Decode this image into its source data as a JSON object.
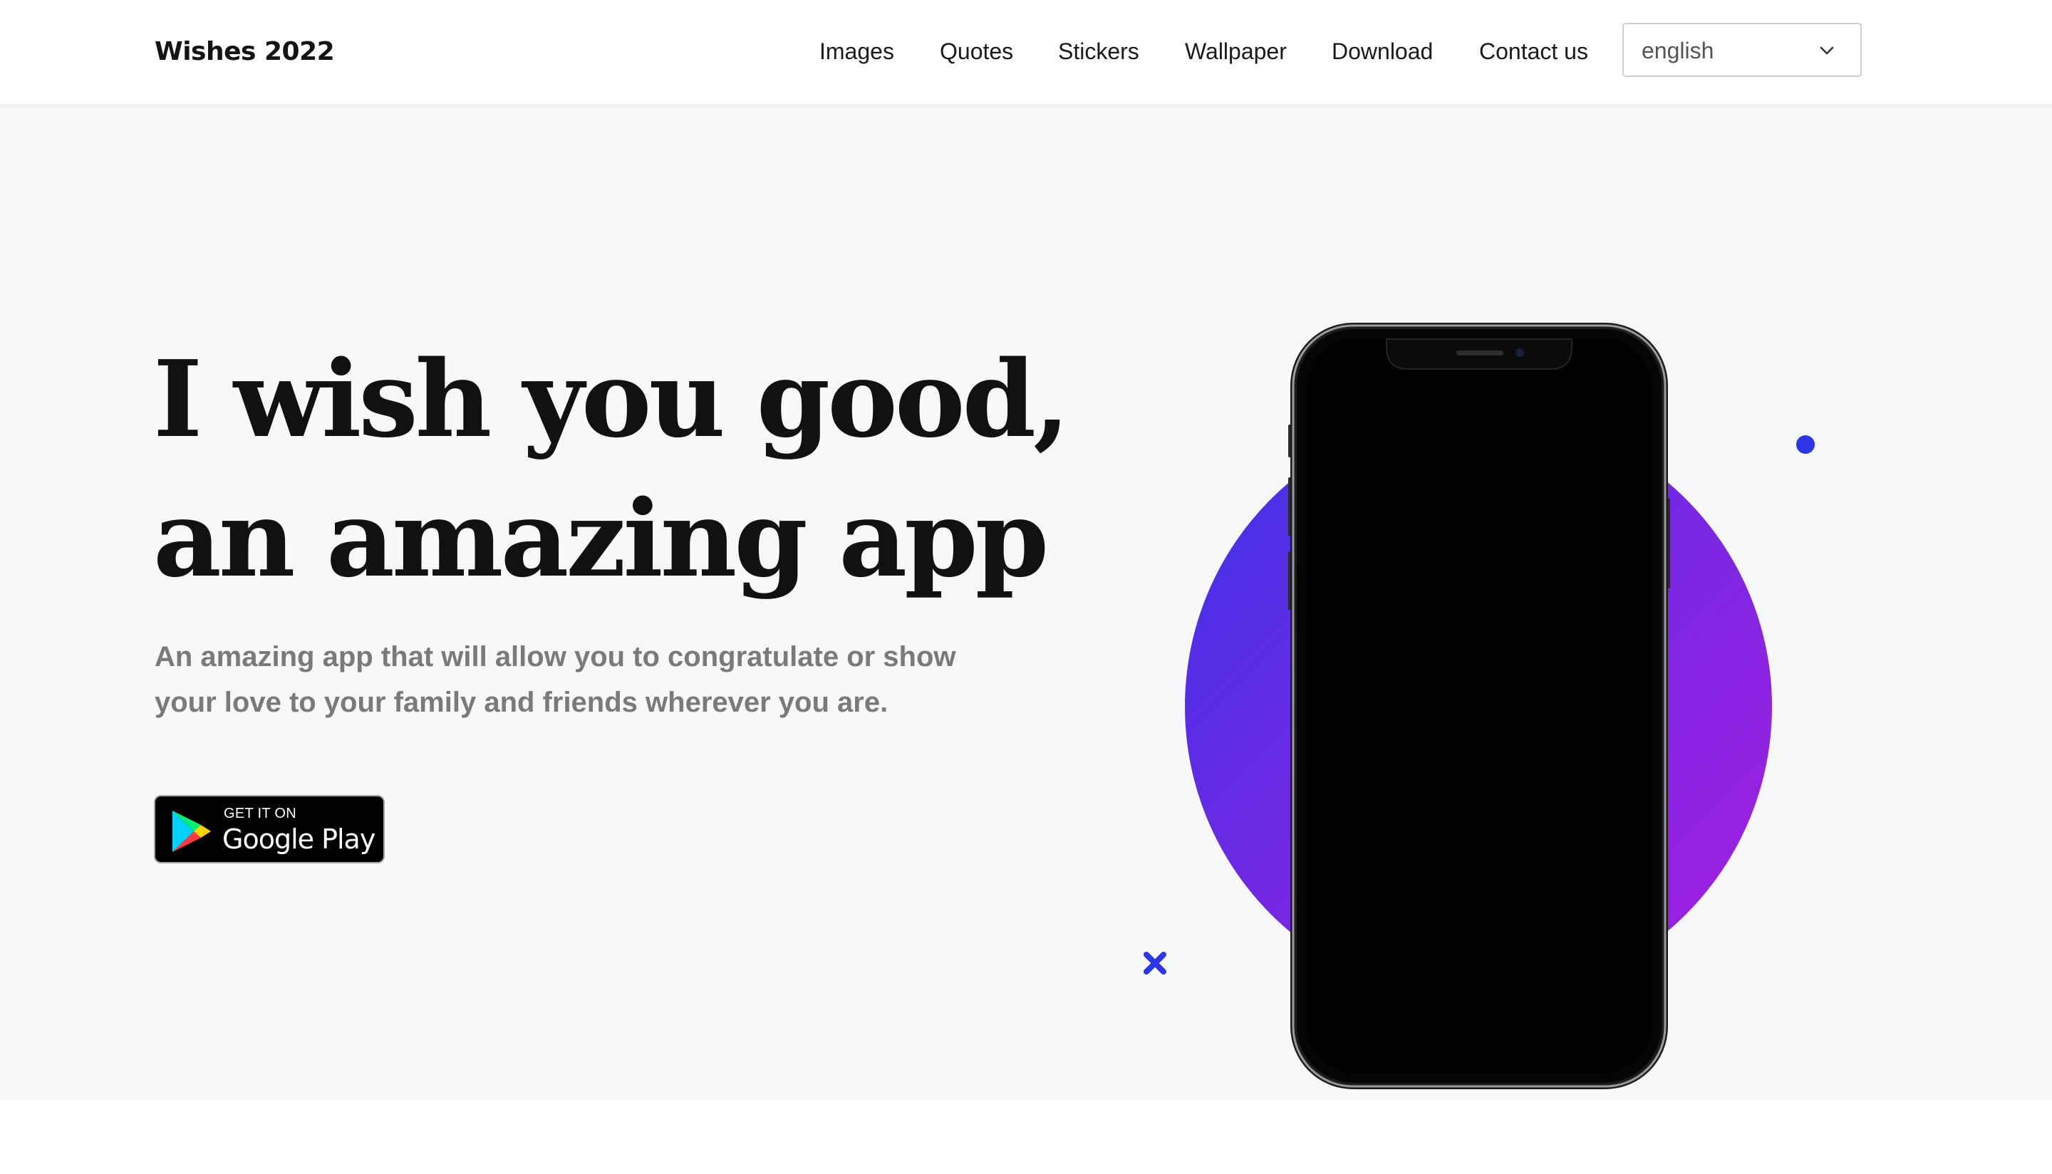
{
  "header": {
    "brand": "Wishes 2022",
    "nav": [
      "Images",
      "Quotes",
      "Stickers",
      "Wallpaper",
      "Download",
      "Contact us"
    ],
    "language": {
      "selected": "english",
      "icon": "chevron-down-icon"
    }
  },
  "hero": {
    "headline_line1": "I wish you good,",
    "headline_line2": "an amazing app",
    "subtitle": "An amazing app that will allow you to congratulate or show your love to your family and friends wherever you are.",
    "store_badge": {
      "small_text": "GET IT ON",
      "big_text": "Google Play",
      "icon": "google-play-icon"
    }
  },
  "colors": {
    "accent": "#2d36e6",
    "gradient_start": "#3b32e8",
    "gradient_end": "#a71de0",
    "hero_background": "#f7f8fa"
  }
}
